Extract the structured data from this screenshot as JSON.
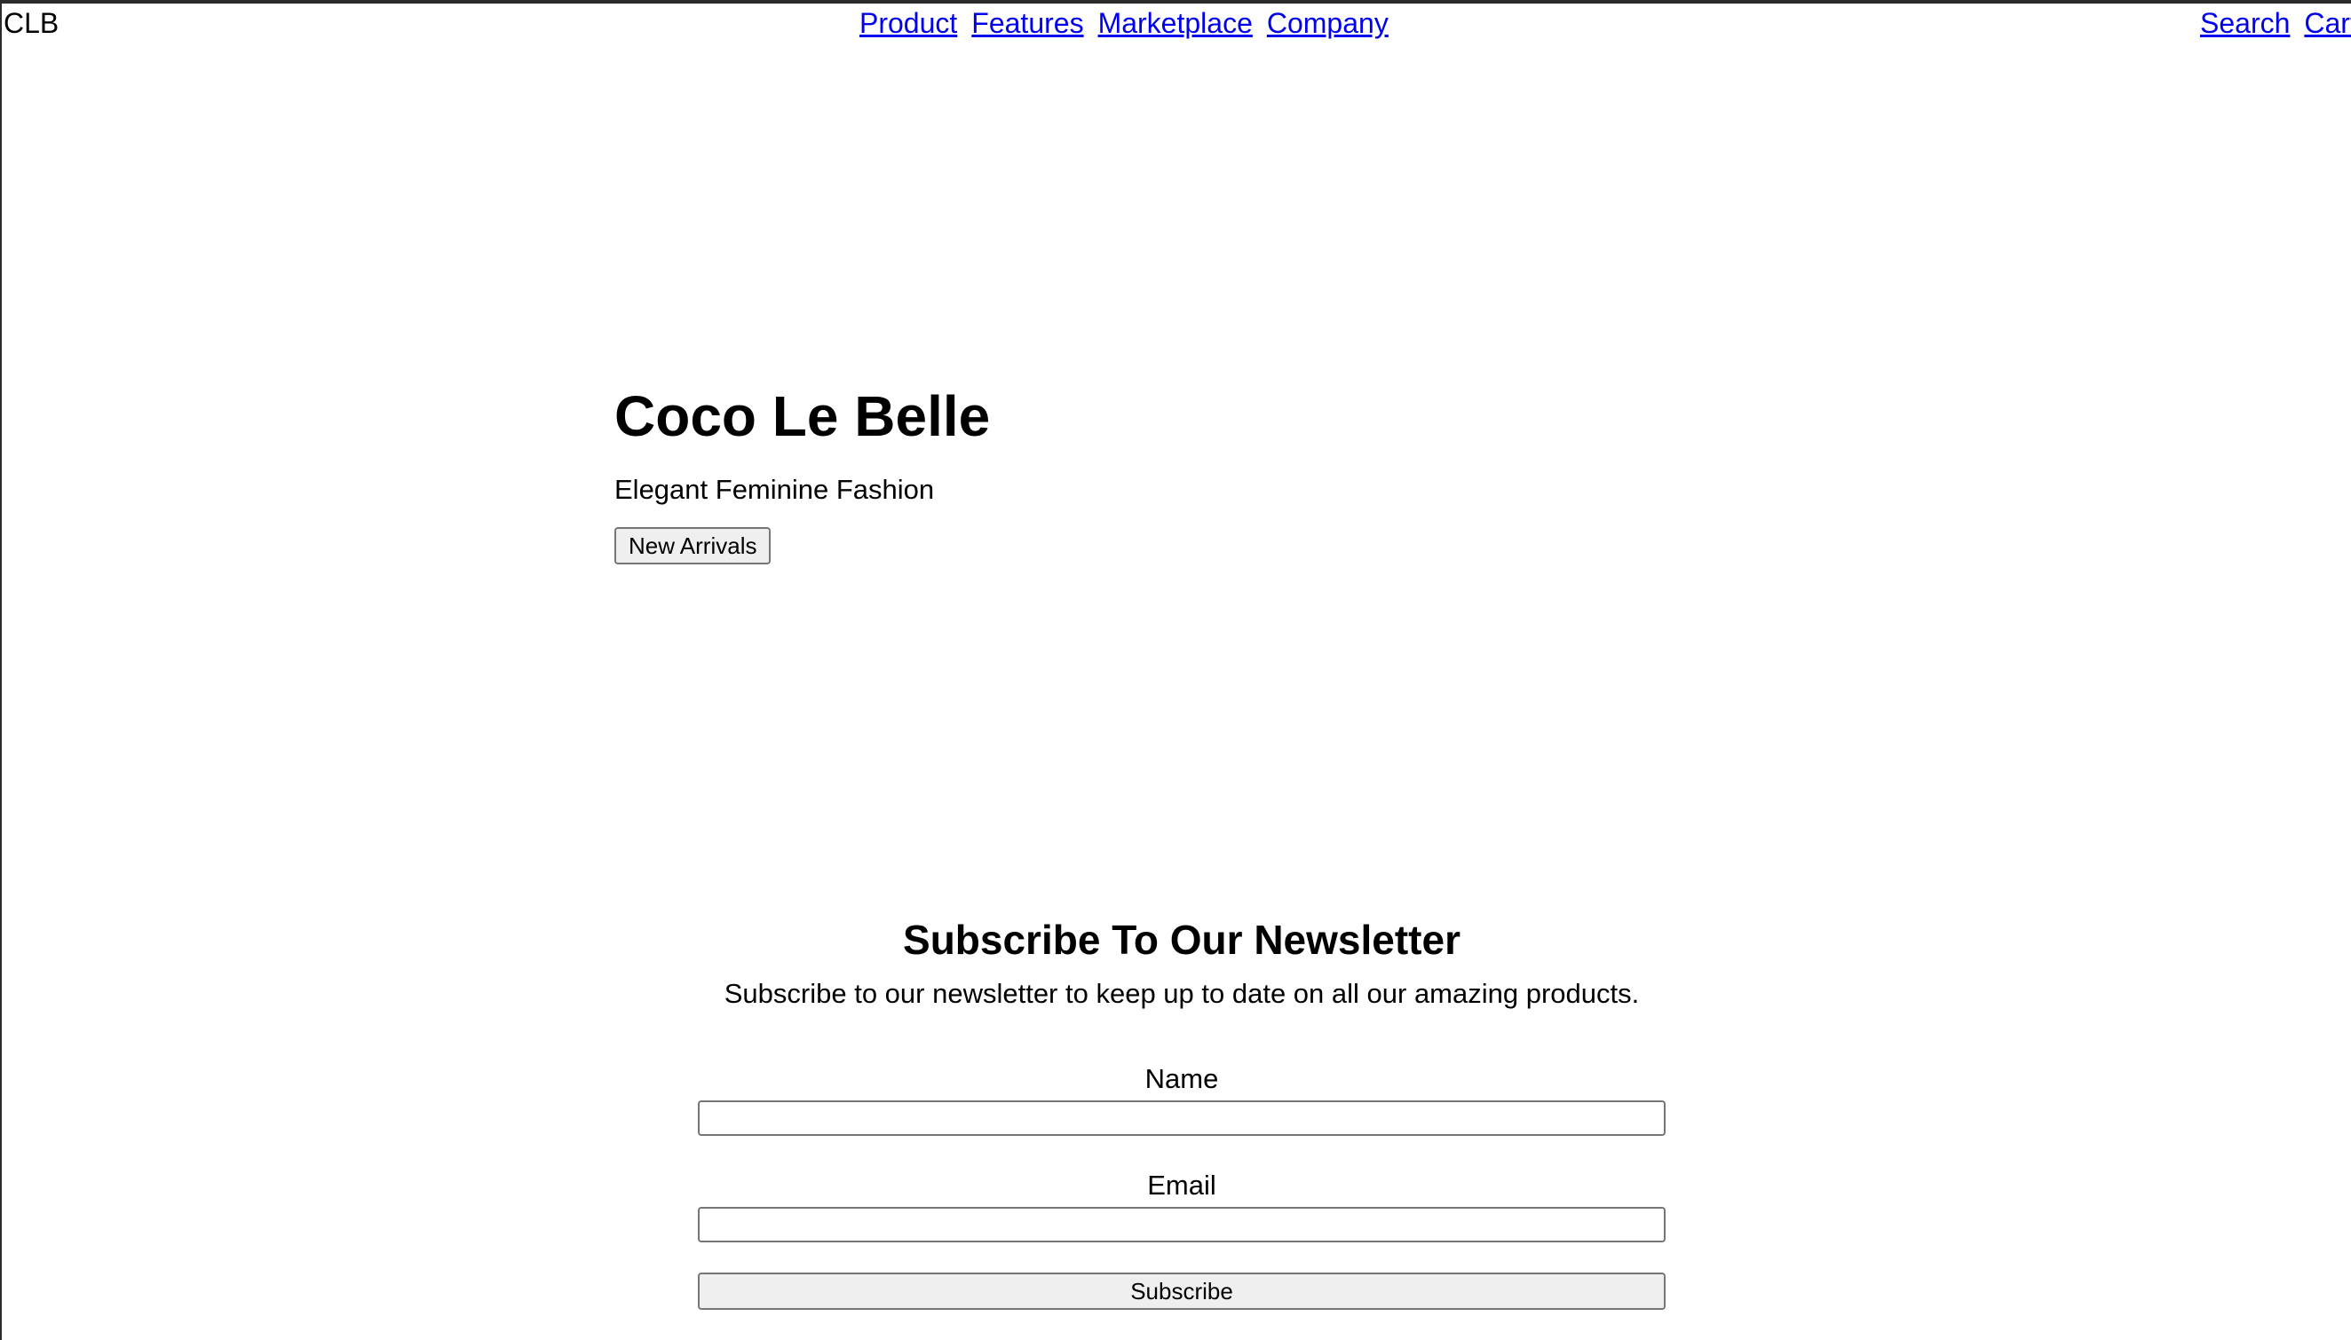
{
  "header": {
    "brand": "CLB",
    "nav_center": [
      "Product",
      "Features",
      "Marketplace",
      "Company"
    ],
    "nav_right": [
      "Search",
      "Cart"
    ]
  },
  "hero": {
    "title": "Coco Le Belle",
    "subtitle": "Elegant Feminine Fashion",
    "button_label": "New Arrivals"
  },
  "newsletter": {
    "title": "Subscribe To Our Newsletter",
    "description": "Subscribe to our newsletter to keep up to date on all our amazing products.",
    "name_label": "Name",
    "email_label": "Email",
    "name_value": "",
    "email_value": "",
    "submit_label": "Subscribe"
  },
  "colors": {
    "link": "#0000ee",
    "text": "#000000",
    "button_bg": "#efefef",
    "border": "#767676"
  }
}
